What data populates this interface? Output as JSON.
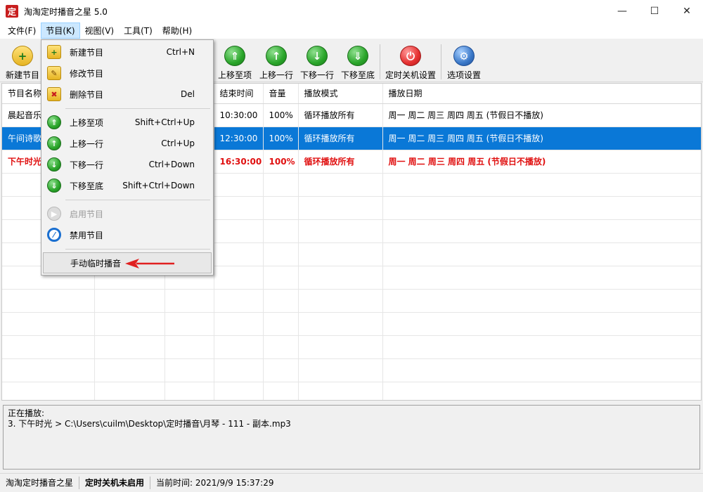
{
  "window": {
    "title": "淘淘定时播音之星 5.0",
    "icon_text": "定"
  },
  "menubar": [
    "文件(F)",
    "节目(K)",
    "视图(V)",
    "工具(T)",
    "帮助(H)"
  ],
  "toolbar": {
    "new": "新建节目",
    "move_top": "上移至项",
    "move_up": "上移一行",
    "move_down": "下移一行",
    "move_bottom": "下移至底",
    "shutdown": "定时关机设置",
    "options": "选项设置"
  },
  "table": {
    "headers": [
      "节目名称",
      "",
      "",
      "结束时间",
      "音量",
      "播放模式",
      "播放日期"
    ],
    "rows": [
      [
        "晨起音乐",
        "",
        "",
        "10:30:00",
        "100%",
        "循环播放所有",
        "周一 周二 周三 周四 周五 (节假日不播放)"
      ],
      [
        "午间诗歌",
        "",
        "",
        "12:30:00",
        "100%",
        "循环播放所有",
        "周一 周二 周三 周四 周五 (节假日不播放)"
      ],
      [
        "下午时光",
        "",
        "",
        "16:30:00",
        "100%",
        "循环播放所有",
        "周一 周二 周三 周四 周五 (节假日不播放)"
      ]
    ]
  },
  "now_playing": {
    "label": "正在播放:",
    "detail": "3. 下午时光 > C:\\Users\\cuilm\\Desktop\\定时播音\\月琴 - 111 - 副本.mp3"
  },
  "statusbar": {
    "app": "淘淘定时播音之星",
    "shutdown_status": "定时关机未启用",
    "time": "当前时间:  2021/9/9 15:37:29"
  },
  "dropdown": {
    "items": [
      {
        "label": "新建节目",
        "shortcut": "Ctrl+N"
      },
      {
        "label": "修改节目",
        "shortcut": ""
      },
      {
        "label": "删除节目",
        "shortcut": "Del"
      },
      {
        "label": "上移至项",
        "shortcut": "Shift+Ctrl+Up"
      },
      {
        "label": "上移一行",
        "shortcut": "Ctrl+Up"
      },
      {
        "label": "下移一行",
        "shortcut": "Ctrl+Down"
      },
      {
        "label": "下移至底",
        "shortcut": "Shift+Ctrl+Down"
      },
      {
        "label": "启用节目",
        "shortcut": ""
      },
      {
        "label": "禁用节目",
        "shortcut": ""
      },
      {
        "label": "手动临时播音",
        "shortcut": ""
      }
    ]
  },
  "colors": {
    "selection": "#0a78d7",
    "playing_text": "#e01010",
    "annotation_arrow": "#e02020"
  }
}
